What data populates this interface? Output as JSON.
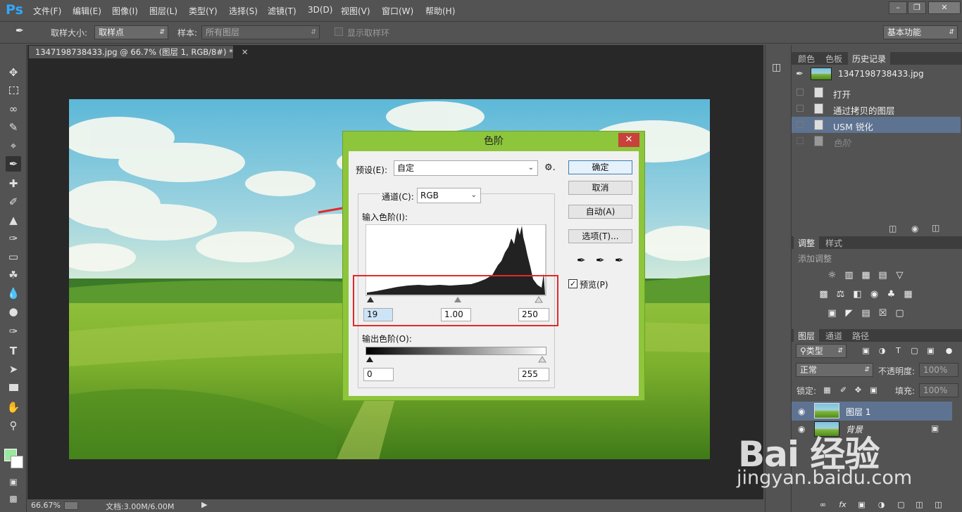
{
  "app": {
    "logo": "Ps"
  },
  "menu": [
    "文件(F)",
    "编辑(E)",
    "图像(I)",
    "图层(L)",
    "类型(Y)",
    "选择(S)",
    "滤镜(T)",
    "3D(D)",
    "视图(V)",
    "窗口(W)",
    "帮助(H)"
  ],
  "options": {
    "sample_size_label": "取样大小:",
    "sample_size_value": "取样点",
    "sample_label": "样本:",
    "sample_value": "所有图层",
    "show_ring_label": "显示取样环",
    "workspace": "基本功能"
  },
  "document": {
    "tab_title": "1347198738433.jpg @ 66.7% (图层 1, RGB/8#) *",
    "zoom": "66.67%",
    "doc_size": "文档:3.00M/6.00M"
  },
  "history_panel": {
    "tabs": [
      "颜色",
      "色板",
      "历史记录"
    ],
    "snapshot": "1347198738433.jpg",
    "items": [
      "打开",
      "通过拷贝的图层",
      "USM 锐化",
      "色阶"
    ]
  },
  "adjust_panel": {
    "tabs": [
      "调整",
      "样式"
    ],
    "add_label": "添加调整"
  },
  "layers_panel": {
    "tabs": [
      "图层",
      "通道",
      "路径"
    ],
    "filter_kind": "类型",
    "blend_mode": "正常",
    "opacity_label": "不透明度:",
    "opacity_value": "100%",
    "lock_label": "锁定:",
    "fill_label": "填充:",
    "fill_value": "100%",
    "layers": [
      "图层 1",
      "背景"
    ]
  },
  "levels_dialog": {
    "title": "色阶",
    "preset_label": "预设(E):",
    "preset_value": "自定",
    "channel_label": "通道(C):",
    "channel_value": "RGB",
    "input_levels_label": "输入色阶(I):",
    "output_levels_label": "输出色阶(O):",
    "input_black": "19",
    "input_gamma": "1.00",
    "input_white": "250",
    "output_black": "0",
    "output_white": "255",
    "ok": "确定",
    "cancel": "取消",
    "auto": "自动(A)",
    "options": "选项(T)...",
    "preview_label": "预览(P)"
  },
  "watermark": {
    "brand": "Bai 经验",
    "url": "jingyan.baidu.com"
  },
  "colors": {
    "ui_bg": "#535353",
    "canvas_bg": "#282828",
    "dialog_frame": "#8dc53b",
    "highlight_box": "#e02a2a",
    "selected_history": "#5e7391"
  }
}
